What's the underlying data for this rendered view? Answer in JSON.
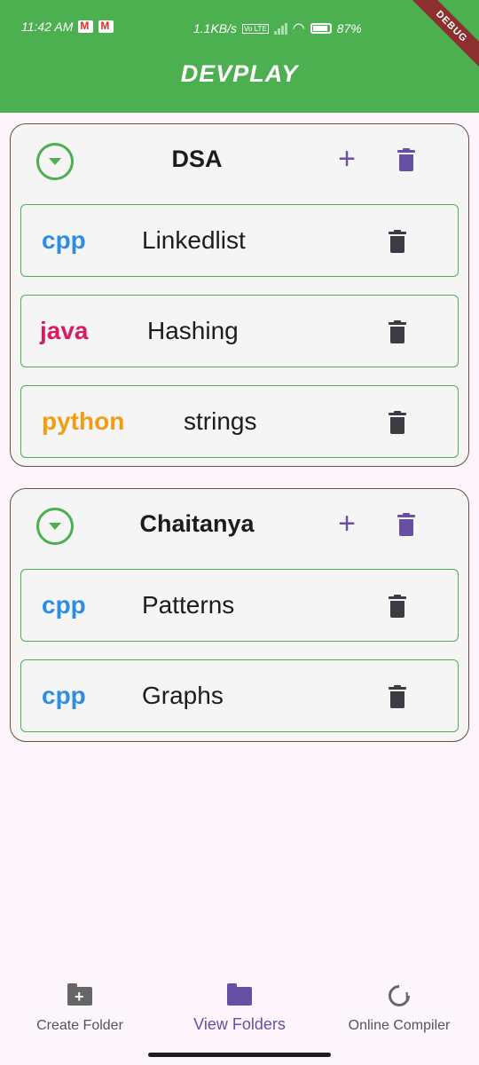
{
  "status_bar": {
    "time": "11:42 AM",
    "speed": "1.1KB/s",
    "volte": "Vo LTE",
    "battery": "87%"
  },
  "debug_banner": "DEBUG",
  "app": {
    "title": "DEVPLAY",
    "header_color": "#4caf50"
  },
  "colors": {
    "cpp": "#2e8de0",
    "java": "#d81b60",
    "python": "#f39c12",
    "accent": "#6750a4"
  },
  "folders": [
    {
      "name": "DSA",
      "add_icon": "+",
      "files": [
        {
          "lang": "cpp",
          "name": "Linkedlist"
        },
        {
          "lang": "java",
          "name": "Hashing"
        },
        {
          "lang": "python",
          "name": "strings"
        }
      ]
    },
    {
      "name": "Chaitanya",
      "add_icon": "+",
      "files": [
        {
          "lang": "cpp",
          "name": "Patterns"
        },
        {
          "lang": "cpp",
          "name": "Graphs"
        }
      ]
    }
  ],
  "bottom_nav": {
    "items": [
      {
        "label": "Create Folder",
        "icon": "create-folder-icon",
        "active": false
      },
      {
        "label": "View Folders",
        "icon": "folder-icon",
        "active": true
      },
      {
        "label": "Online Compiler",
        "icon": "compiler-icon",
        "active": false
      }
    ]
  }
}
